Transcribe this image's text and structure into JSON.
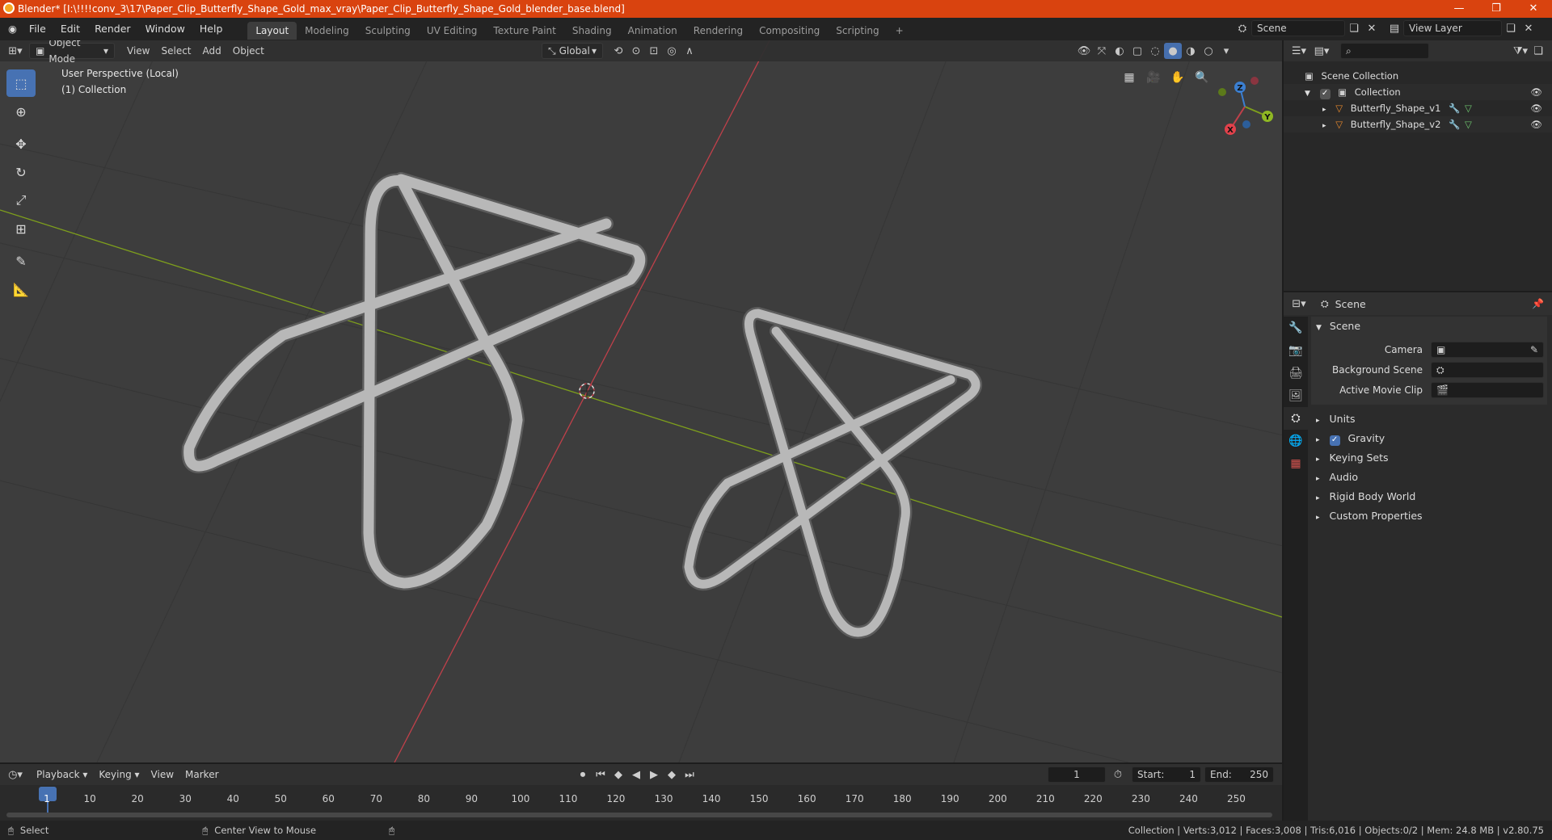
{
  "window": {
    "title": "Blender* [I:\\!!!!conv_3\\17\\Paper_Clip_Butterfly_Shape_Gold_max_vray\\Paper_Clip_Butterfly_Shape_Gold_blender_base.blend]",
    "minimize": "—",
    "maximize": "❐",
    "close": "✕"
  },
  "menubar": {
    "items": [
      "File",
      "Edit",
      "Render",
      "Window",
      "Help"
    ],
    "workspaces": [
      "Layout",
      "Modeling",
      "Sculpting",
      "UV Editing",
      "Texture Paint",
      "Shading",
      "Animation",
      "Rendering",
      "Compositing",
      "Scripting"
    ],
    "add_tab": "+",
    "scene_name": "Scene",
    "view_layer": "View Layer"
  },
  "viewport_header": {
    "mode": "Object Mode",
    "menus": [
      "View",
      "Select",
      "Add",
      "Object"
    ],
    "orientation": "Global"
  },
  "viewport": {
    "perspective_label": "User Perspective (Local)",
    "collection_label": "(1) Collection",
    "gizmo": {
      "x": "X",
      "y": "Y",
      "z": "Z"
    }
  },
  "outliner": {
    "root": "Scene Collection",
    "collection": "Collection",
    "objects": [
      "Butterfly_Shape_v1",
      "Butterfly_Shape_v2"
    ]
  },
  "properties": {
    "context": "Scene",
    "panel_title": "Scene",
    "fields": {
      "camera_label": "Camera",
      "background_scene_label": "Background Scene",
      "active_movie_clip_label": "Active Movie Clip"
    },
    "subpanels": [
      "Units",
      "Gravity",
      "Keying Sets",
      "Audio",
      "Rigid Body World",
      "Custom Properties"
    ]
  },
  "timeline": {
    "menus": [
      "Playback",
      "Keying",
      "View",
      "Marker"
    ],
    "current_frame": "1",
    "start_label": "Start:",
    "start": "1",
    "end_label": "End:",
    "end": "250",
    "ticks": [
      "1",
      "10",
      "20",
      "30",
      "40",
      "50",
      "60",
      "70",
      "80",
      "90",
      "100",
      "110",
      "120",
      "130",
      "140",
      "150",
      "160",
      "170",
      "180",
      "190",
      "200",
      "210",
      "220",
      "230",
      "240",
      "250"
    ]
  },
  "statusbar": {
    "left_action": "Select",
    "middle_action": "Center View to Mouse",
    "stats": "Collection | Verts:3,012 | Faces:3,008 | Tris:6,016 | Objects:0/2 | Mem: 24.8 MB | v2.80.75"
  },
  "colors": {
    "title_bar": "#d9430f",
    "accent": "#4772b3",
    "x_axis": "#c0404a",
    "y_axis": "#7e9f1c",
    "object_orange": "#e8892c",
    "mesh_green": "#6ec56e"
  }
}
